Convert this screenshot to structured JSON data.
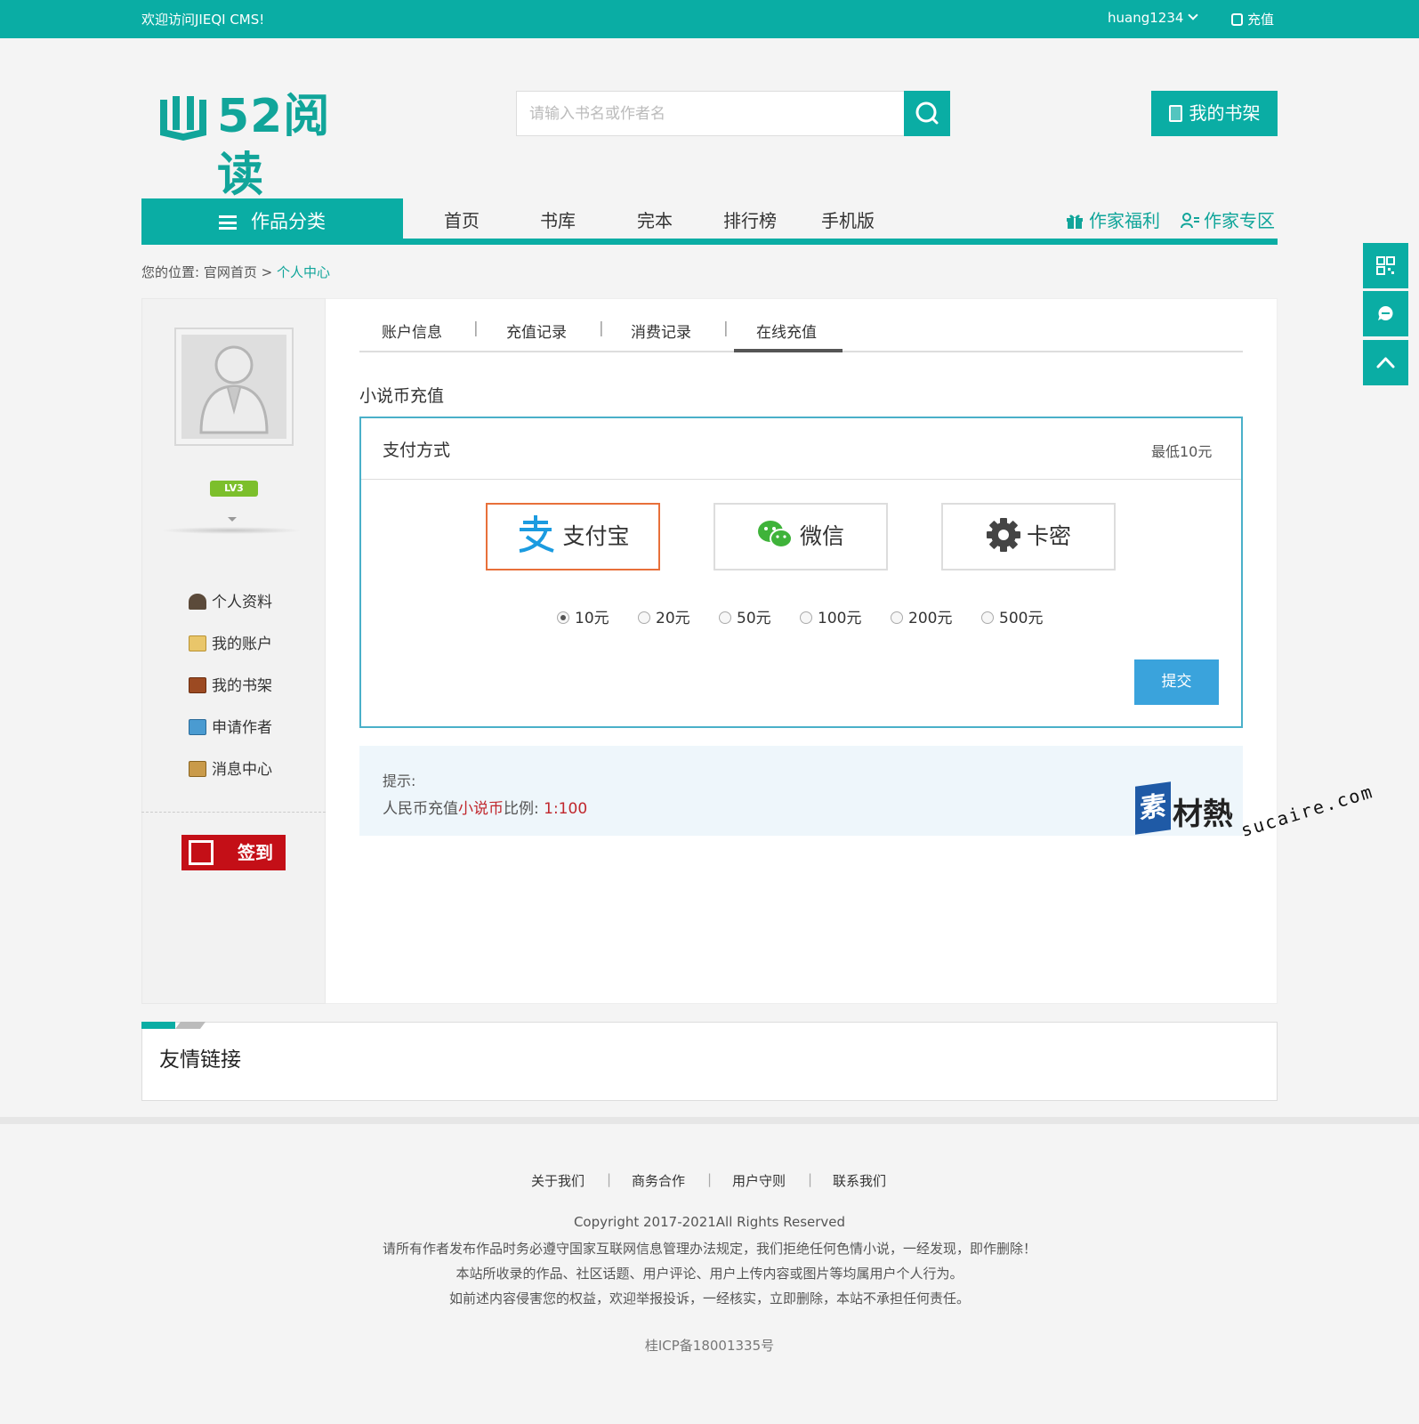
{
  "topbar": {
    "welcome": "欢迎访问JIEQI CMS!",
    "username": "huang1234",
    "recharge": "充值"
  },
  "header": {
    "logo_text": "52阅读",
    "search_placeholder": "请输入书名或作者名",
    "my_shelf": "我的书架"
  },
  "nav": {
    "category": "作品分类",
    "items": [
      "首页",
      "书库",
      "完本",
      "排行榜",
      "手机版"
    ],
    "author_welfare": "作家福利",
    "author_zone": "作家专区"
  },
  "breadcrumb": {
    "prefix": "您的位置: 官网首页 >",
    "current": "个人中心"
  },
  "sidebar": {
    "level_badge": "LV3",
    "menu": [
      "个人资料",
      "我的账户",
      "我的书架",
      "申请作者",
      "消息中心"
    ],
    "signin": "签到"
  },
  "tabs": {
    "items": [
      "账户信息",
      "充值记录",
      "消费记录",
      "在线充值"
    ],
    "separator": "|",
    "active": "在线充值"
  },
  "recharge": {
    "section_title": "小说币充值",
    "pay_label": "支付方式",
    "min_amount": "最低10元",
    "methods": [
      "支付宝",
      "微信",
      "卡密"
    ],
    "selected_method": "支付宝",
    "amounts": [
      "10元",
      "20元",
      "50元",
      "100元",
      "200元",
      "500元"
    ],
    "selected_amount": "10元",
    "submit": "提交"
  },
  "tip": {
    "title": "提示:",
    "text_prefix": "人民币充值",
    "text_highlight": "小说币",
    "text_mid": "比例: ",
    "ratio": "1:100"
  },
  "watermark": {
    "mark": "素",
    "cn": "材熱",
    "en": "sucaire.com"
  },
  "friend_links": {
    "title": "友情链接"
  },
  "footer": {
    "links": [
      "关于我们",
      "商务合作",
      "用户守则",
      "联系我们"
    ],
    "separator": "|",
    "copyright": "Copyright 2017-2021All Rights Reserved",
    "notice1": "请所有作者发布作品时务必遵守国家互联网信息管理办法规定，我们拒绝任何色情小说，一经发现，即作删除！",
    "notice2": "本站所收录的作品、社区话题、用户评论、用户上传内容或图片等均属用户个人行为。",
    "notice3": "如前述内容侵害您的权益，欢迎举报投诉，一经核实，立即删除，本站不承担任何责任。",
    "icp": "桂ICP备18001335号"
  },
  "colors": {
    "brand": "#0aada4",
    "pay_border": "#4ab0c9",
    "active_option": "#e8703a",
    "submit": "#3aa3dc",
    "signin": "#c40f17",
    "highlight_red": "#c0272d"
  },
  "icons": [
    "coin-icon",
    "book-logo-icon",
    "search-icon",
    "shelf-icon",
    "menu-icon",
    "gift-icon",
    "author-icon",
    "alipay-icon",
    "wechat-icon",
    "gear-icon",
    "qrcode-icon",
    "service-icon",
    "back-to-top-icon"
  ]
}
